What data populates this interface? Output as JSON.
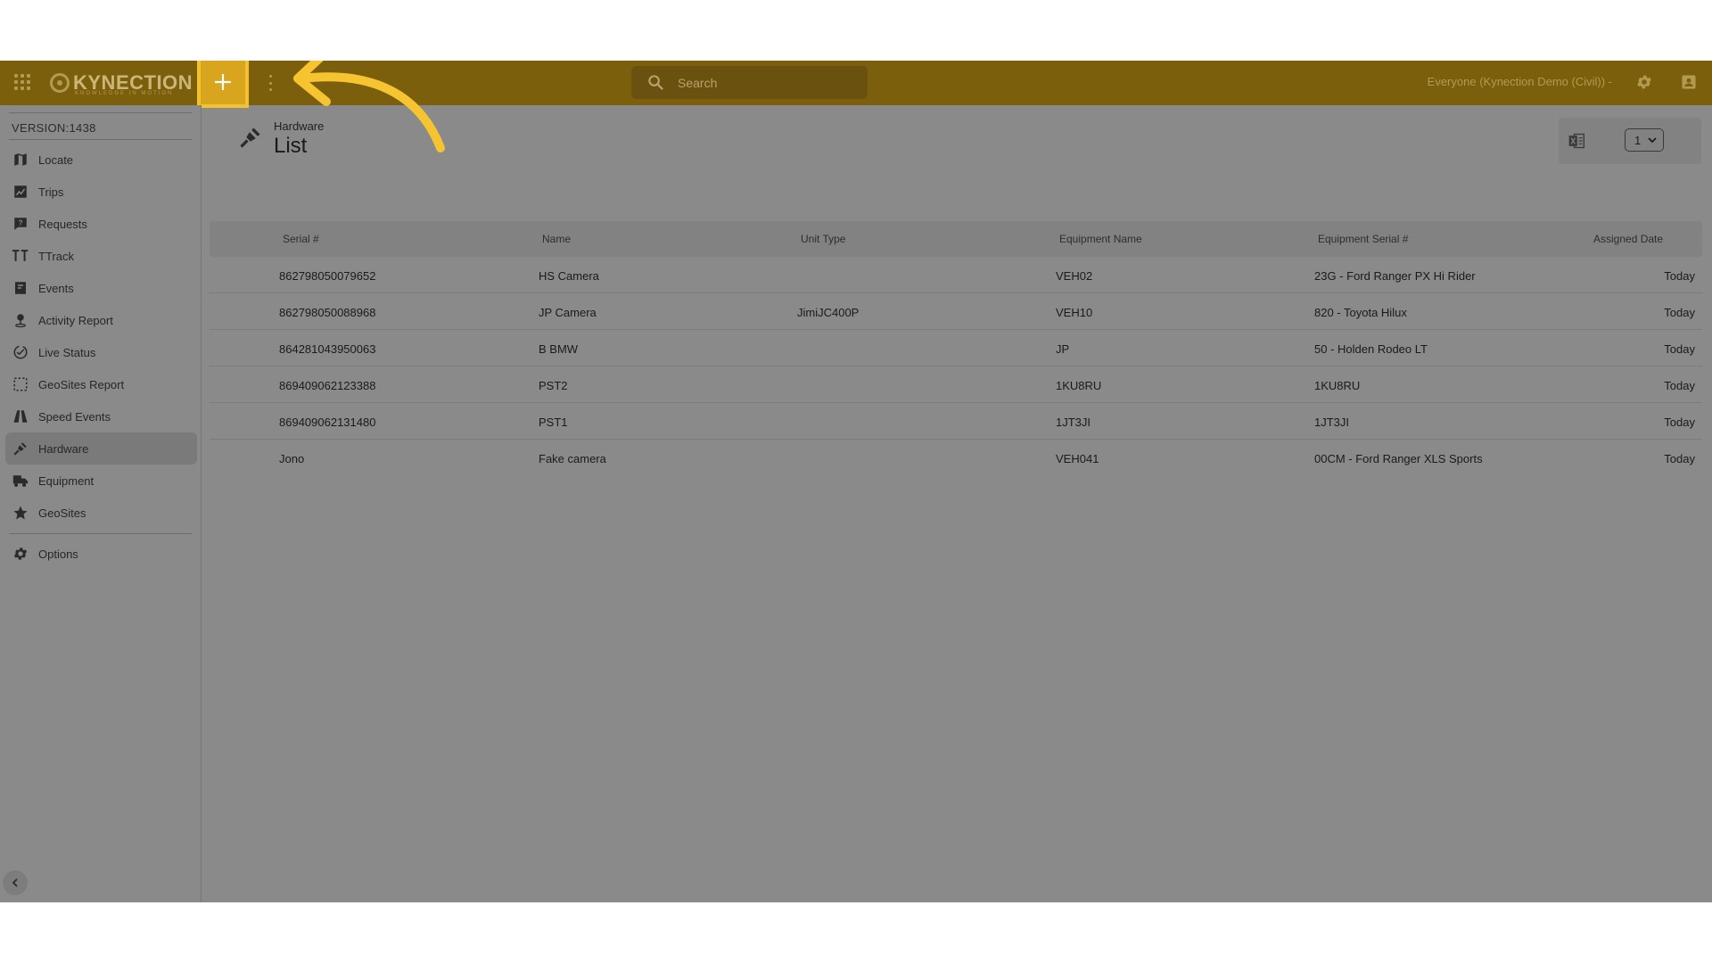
{
  "app": {
    "logo_text": "KYNECTION",
    "logo_tagline": "KNOWLEDGE IN MOTION"
  },
  "header": {
    "search_placeholder": "Search",
    "context_label": "Everyone (Kynection Demo (Civil)) -"
  },
  "sidebar": {
    "version": "VERSION:1438",
    "items": [
      {
        "label": "Locate",
        "icon": "map-icon"
      },
      {
        "label": "Trips",
        "icon": "trips-icon"
      },
      {
        "label": "Requests",
        "icon": "request-icon"
      },
      {
        "label": "TTrack",
        "icon": "ttrack-icon"
      },
      {
        "label": "Events",
        "icon": "events-icon"
      },
      {
        "label": "Activity Report",
        "icon": "person-pin-icon"
      },
      {
        "label": "Live Status",
        "icon": "check-circle-icon"
      },
      {
        "label": "GeoSites Report",
        "icon": "dashed-square-icon"
      },
      {
        "label": "Speed Events",
        "icon": "road-icon"
      },
      {
        "label": "Hardware",
        "icon": "plug-icon",
        "active": true
      },
      {
        "label": "Equipment",
        "icon": "truck-icon"
      },
      {
        "label": "GeoSites",
        "icon": "star-icon"
      }
    ],
    "options_label": "Options"
  },
  "page": {
    "breadcrumb": "Hardware",
    "title": "List",
    "page_number": "1"
  },
  "table": {
    "columns": [
      "Serial #",
      "Name",
      "Unit Type",
      "Equipment Name",
      "Equipment Serial #",
      "Assigned Date"
    ],
    "rows": [
      [
        "862798050079652",
        "HS Camera",
        "",
        "VEH02",
        "23G - Ford Ranger PX Hi Rider",
        "Today"
      ],
      [
        "862798050088968",
        "JP Camera",
        "JimiJC400P",
        "VEH10",
        "820 - Toyota Hilux",
        "Today"
      ],
      [
        "864281043950063",
        "B BMW",
        "",
        "JP",
        "50 - Holden Rodeo LT",
        "Today"
      ],
      [
        "869409062123388",
        "PST2",
        "",
        "1KU8RU",
        "1KU8RU",
        "Today"
      ],
      [
        "869409062131480",
        "PST1",
        "",
        "1JT3JI",
        "1JT3JI",
        "Today"
      ],
      [
        "Jono",
        "Fake camera",
        "",
        "VEH041",
        "00CM - Ford Ranger XLS Sports",
        "Today"
      ]
    ]
  },
  "colors": {
    "topbar": "#7c5f0c",
    "highlight": "#f3c32e",
    "overlay": "#8a8a8a",
    "arrow": "#f6c431"
  }
}
